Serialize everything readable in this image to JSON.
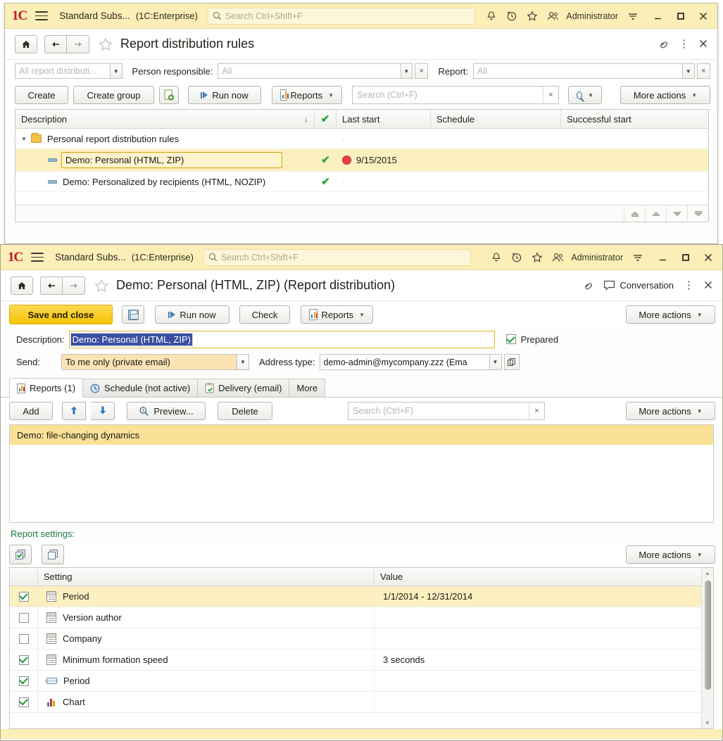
{
  "app": {
    "logo": "1C",
    "name": "Standard Subs...",
    "edition": "(1C:Enterprise)",
    "search_placeholder": "Search Ctrl+Shift+F",
    "user": "Administrator",
    "icons": {
      "hamburger": "menu-icon",
      "bell": "notifications-icon",
      "history": "history-icon",
      "star": "favorites-icon",
      "users": "users-icon",
      "options": "options-icon",
      "minimize": "minimize-icon",
      "maximize": "maximize-icon",
      "close": "close-icon"
    }
  },
  "colors": {
    "title_bar": "#fbeeb6",
    "accent_yellow": "#f5c400",
    "row_selected": "#fdf0c0",
    "list_selected": "#fbe196",
    "green_check": "#2aa33f",
    "section_label_green": "#1f7a42",
    "selection_blue": "#3b4fa0",
    "red_dot": "#e8453c"
  },
  "main_window": {
    "nav": {
      "home": "⌂",
      "back": "←",
      "forward": "→"
    },
    "title": "Report distribution rules",
    "right_icons": {
      "link": "link-icon",
      "kebab": "more-menu-icon",
      "close": "close-icon"
    },
    "filters": {
      "list_selector_placeholder": "All report distributi...",
      "person_label": "Person responsible:",
      "person_value": "All",
      "report_label": "Report:",
      "report_value": "All"
    },
    "toolbar": {
      "create": "Create",
      "create_group": "Create group",
      "copy_icon": "create-copy-icon",
      "run_now": "Run now",
      "reports": "Reports",
      "search_placeholder": "Search (Ctrl+F)",
      "search_value": "",
      "find_icon": "search-icon",
      "more_actions": "More actions"
    },
    "table": {
      "columns": [
        "Description",
        "",
        "Last start",
        "Schedule",
        "Successful start"
      ],
      "sort_indicator": "↓",
      "check_column_icon": "green-check-icon",
      "rows": [
        {
          "type": "group",
          "icon": "folder-icon",
          "description": "Personal report distribution rules",
          "checked": false,
          "last_start": "",
          "schedule": "",
          "successful_start": ""
        },
        {
          "type": "item",
          "icon": "rule-icon",
          "description": "Demo: Personal (HTML, ZIP)",
          "checked": true,
          "status": "red-dot-icon",
          "last_start": "9/15/2015",
          "schedule": "",
          "successful_start": "",
          "selected": true
        },
        {
          "type": "item",
          "icon": "rule-icon",
          "description": "Demo: Personalized by recipients (HTML, NOZIP)",
          "checked": true,
          "last_start": "",
          "schedule": "",
          "successful_start": "",
          "selected": false
        }
      ]
    },
    "footer_nav": [
      "first-icon",
      "up-icon",
      "down-icon",
      "last-icon"
    ]
  },
  "dialog_window": {
    "nav": {
      "home": "⌂",
      "back": "←",
      "forward": "→"
    },
    "title": "Demo: Personal (HTML, ZIP) (Report distribution)",
    "conversation_label": "Conversation",
    "right_icons": {
      "link": "link-icon",
      "conversation": "conversation-icon",
      "kebab": "more-menu-icon",
      "close": "close-icon"
    },
    "toolbar": {
      "save_and_close": "Save and close",
      "save_icon": "save-icon",
      "run_now": "Run now",
      "check": "Check",
      "reports": "Reports",
      "more_actions": "More actions"
    },
    "form": {
      "description_label": "Description:",
      "description_value": "Demo: Personal (HTML, ZIP)",
      "prepared_label": "Prepared",
      "prepared_checked": true,
      "send_label": "Send:",
      "send_value": "To me only (private email)",
      "address_type_label": "Address type:",
      "address_type_value": "demo-admin@mycompany.zzz (Ema",
      "address_open_icon": "open-link-icon"
    },
    "tabs": [
      {
        "label": "Reports (1)",
        "icon": "report-icon",
        "active": true
      },
      {
        "label": "Schedule (not active)",
        "icon": "clock-icon",
        "active": false
      },
      {
        "label": "Delivery (email)",
        "icon": "clipboard-check-icon",
        "active": false
      },
      {
        "label": "More",
        "icon": "",
        "active": false
      }
    ],
    "reports_toolbar": {
      "add": "Add",
      "move_up_icon": "arrow-up-icon",
      "move_down_icon": "arrow-down-icon",
      "preview": "Preview...",
      "delete": "Delete",
      "search_placeholder": "Search (Ctrl+F)",
      "search_value": "",
      "more_actions": "More actions"
    },
    "reports_list": [
      {
        "label": "Demo: file-changing dynamics",
        "selected": true
      }
    ],
    "report_settings": {
      "section_label": "Report settings:",
      "toolbar_icons": [
        "check-stack-icon",
        "copy-stack-icon"
      ],
      "more_actions": "More actions",
      "columns": [
        "",
        "Setting",
        "Value"
      ],
      "rows": [
        {
          "checked": true,
          "icon": "calendar-icon",
          "setting": "Period",
          "value": "1/1/2014 - 12/31/2014",
          "selected": true
        },
        {
          "checked": false,
          "icon": "calendar-icon",
          "setting": "Version author",
          "value": "",
          "selected": false
        },
        {
          "checked": false,
          "icon": "calendar-icon",
          "setting": "Company",
          "value": "",
          "selected": false
        },
        {
          "checked": true,
          "icon": "calendar-icon",
          "setting": "Minimum formation speed",
          "value": "3 seconds",
          "selected": false
        },
        {
          "checked": true,
          "icon": "number-icon",
          "setting": "Period",
          "value": "",
          "selected": false
        },
        {
          "checked": true,
          "icon": "chart-icon",
          "setting": "Chart",
          "value": "",
          "selected": false
        }
      ]
    }
  }
}
